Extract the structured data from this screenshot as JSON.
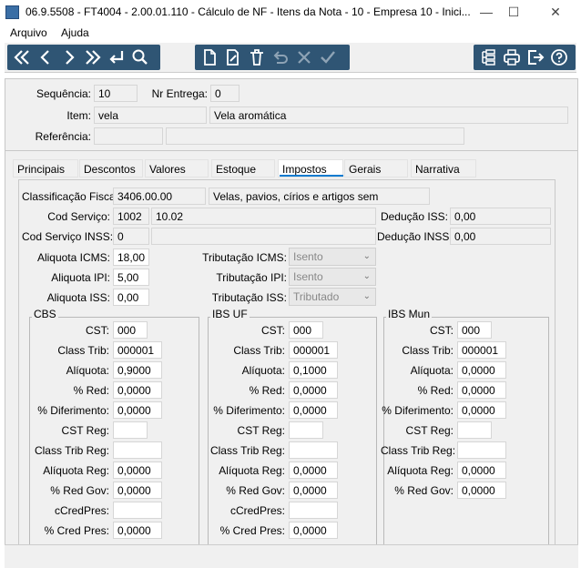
{
  "window": {
    "title": "06.9.5508 - FT4004 - 2.00.01.110 - Cálculo de NF - Itens da Nota - 10 - Empresa 10 - Inici...",
    "minimize": "—",
    "maximize": "☐",
    "close": "✕"
  },
  "menu": [
    "Arquivo",
    "Ajuda"
  ],
  "header": {
    "sequencia_label": "Sequência:",
    "sequencia": "10",
    "nr_entrega_label": "Nr Entrega:",
    "nr_entrega": "0",
    "item_label": "Item:",
    "item_code": "vela",
    "item_desc": "Vela aromática",
    "referencia_label": "Referência:",
    "referencia": "",
    "referencia_desc": ""
  },
  "tabs": [
    "Principais",
    "Descontos",
    "Valores",
    "Estoque",
    "Impostos",
    "Gerais",
    "Narrativa"
  ],
  "active_tab": "Impostos",
  "impostos": {
    "class_fiscal_label": "Classificação Fiscal:",
    "class_fiscal_code": "3406.00.00",
    "class_fiscal_desc": "Velas, pavios, círios e artigos sem",
    "cod_servico_label": "Cod Serviço:",
    "cod_servico": "1002",
    "cod_servico_desc": "10.02",
    "cod_servico_inss_label": "Cod Serviço INSS:",
    "cod_servico_inss": "0",
    "cod_servico_inss_desc": "",
    "deducao_iss_label": "Dedução ISS:",
    "deducao_iss": "0,00",
    "deducao_inss_label": "Dedução INSS:",
    "deducao_inss": "0,00",
    "aliquota_icms_label": "Aliquota ICMS:",
    "aliquota_icms": "18,00",
    "aliquota_ipi_label": "Aliquota IPI:",
    "aliquota_ipi": "5,00",
    "aliquota_iss_label": "Aliquota ISS:",
    "aliquota_iss": "0,00",
    "trib_icms_label": "Tributação ICMS:",
    "trib_icms": "Isento",
    "trib_ipi_label": "Tributação IPI:",
    "trib_ipi": "Isento",
    "trib_iss_label": "Tributação ISS:",
    "trib_iss": "Tributado"
  },
  "groups": {
    "cbs": {
      "title": "CBS",
      "cst_label": "CST:",
      "cst": "000",
      "class_trib_label": "Class Trib:",
      "class_trib": "000001",
      "aliquota_label": "Alíquota:",
      "aliquota": "0,9000",
      "red_label": "% Red:",
      "red": "0,0000",
      "diferimento_label": "% Diferimento:",
      "diferimento": "0,0000",
      "cst_reg_label": "CST Reg:",
      "cst_reg": "",
      "class_trib_reg_label": "Class Trib Reg:",
      "class_trib_reg": "",
      "aliquota_reg_label": "Alíquota Reg:",
      "aliquota_reg": "0,0000",
      "red_gov_label": "% Red Gov:",
      "red_gov": "0,0000",
      "ccredpres_label": "cCredPres:",
      "ccredpres": "",
      "cred_pres_label": "% Cred Pres:",
      "cred_pres": "0,0000"
    },
    "ibs_uf": {
      "title": "IBS UF",
      "cst_label": "CST:",
      "cst": "000",
      "class_trib_label": "Class Trib:",
      "class_trib": "000001",
      "aliquota_label": "Alíquota:",
      "aliquota": "0,1000",
      "red_label": "% Red:",
      "red": "0,0000",
      "diferimento_label": "% Diferimento:",
      "diferimento": "0,0000",
      "cst_reg_label": "CST Reg:",
      "cst_reg": "",
      "class_trib_reg_label": "Class Trib Reg:",
      "class_trib_reg": "",
      "aliquota_reg_label": "Alíquota Reg:",
      "aliquota_reg": "0,0000",
      "red_gov_label": "% Red Gov:",
      "red_gov": "0,0000",
      "ccredpres_label": "cCredPres:",
      "ccredpres": "",
      "cred_pres_label": "% Cred Pres:",
      "cred_pres": "0,0000"
    },
    "ibs_mun": {
      "title": "IBS Mun",
      "cst_label": "CST:",
      "cst": "000",
      "class_trib_label": "Class Trib:",
      "class_trib": "000001",
      "aliquota_label": "Alíquota:",
      "aliquota": "0,0000",
      "red_label": "% Red:",
      "red": "0,0000",
      "diferimento_label": "% Diferimento:",
      "diferimento": "0,0000",
      "cst_reg_label": "CST Reg:",
      "cst_reg": "",
      "class_trib_reg_label": "Class Trib Reg:",
      "class_trib_reg": "",
      "aliquota_reg_label": "Alíquota Reg:",
      "aliquota_reg": "0,0000",
      "red_gov_label": "% Red Gov:",
      "red_gov": "0,0000"
    }
  },
  "colors": {
    "toolbar": "#2f5574",
    "tab_accent": "#0a7bd0",
    "panel": "#f0f0f0"
  },
  "toolbar_icons": [
    "first-icon",
    "previous-icon",
    "next-icon",
    "last-icon",
    "return-icon",
    "search-icon",
    "new-icon",
    "edit-icon",
    "delete-icon",
    "undo-icon",
    "cancel-icon",
    "confirm-icon",
    "tree-icon",
    "print-icon",
    "exit-icon",
    "help-icon"
  ]
}
